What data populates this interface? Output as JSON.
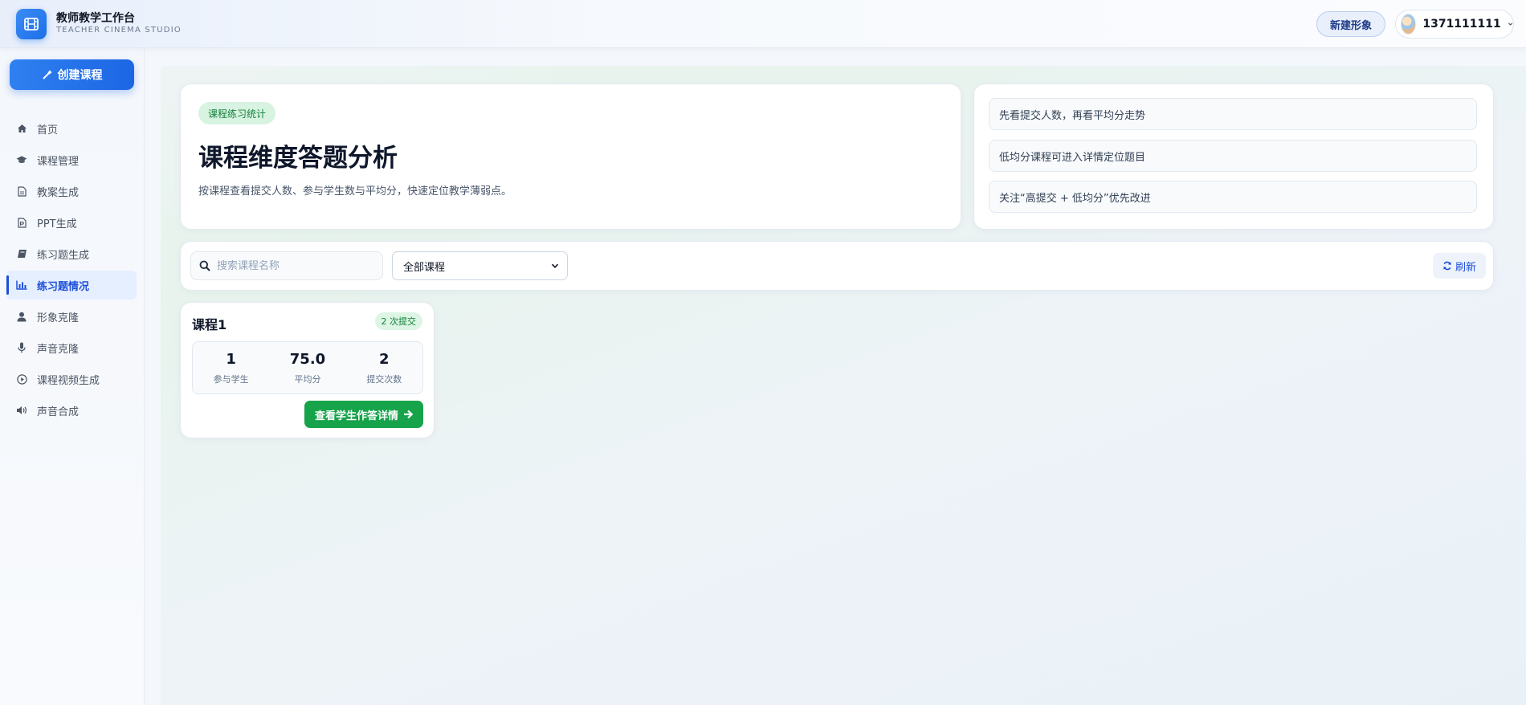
{
  "header": {
    "brand_title": "教师教学工作台",
    "brand_subtitle": "TEACHER CINEMA STUDIO",
    "new_avatar_label": "新建形象",
    "user_name": "1371111111"
  },
  "sidebar": {
    "create_label": "创建课程",
    "items": [
      {
        "label": "首页",
        "icon": "home-icon"
      },
      {
        "label": "课程管理",
        "icon": "graduation-cap-icon"
      },
      {
        "label": "教案生成",
        "icon": "document-icon"
      },
      {
        "label": "PPT生成",
        "icon": "ppt-file-icon"
      },
      {
        "label": "练习题生成",
        "icon": "book-icon"
      },
      {
        "label": "练习题情况",
        "icon": "bar-chart-icon",
        "active": true
      },
      {
        "label": "形象克隆",
        "icon": "user-icon"
      },
      {
        "label": "声音克隆",
        "icon": "microphone-icon"
      },
      {
        "label": "课程视频生成",
        "icon": "play-circle-icon"
      },
      {
        "label": "声音合成",
        "icon": "volume-icon"
      }
    ]
  },
  "hero": {
    "tag": "课程练习统计",
    "title": "课程维度答题分析",
    "description": "按课程查看提交人数、参与学生数与平均分，快速定位教学薄弱点。"
  },
  "tips": [
    "先看提交人数，再看平均分走势",
    "低均分课程可进入详情定位题目",
    "关注“高提交 + 低均分”优先改进"
  ],
  "toolbar": {
    "search_placeholder": "搜索课程名称",
    "select_value": "全部课程",
    "refresh_label": "刷新"
  },
  "courses": [
    {
      "name": "课程1",
      "badge": "2 次提交",
      "stats": [
        {
          "value": "1",
          "label": "参与学生"
        },
        {
          "value": "75.0",
          "label": "平均分"
        },
        {
          "value": "2",
          "label": "提交次数"
        }
      ],
      "detail_label": "查看学生作答详情"
    }
  ],
  "colors": {
    "primary": "#1d6fe8",
    "active_nav": "#1d4fd8",
    "success": "#16a34a",
    "tag_bg": "#d8f3e1"
  }
}
